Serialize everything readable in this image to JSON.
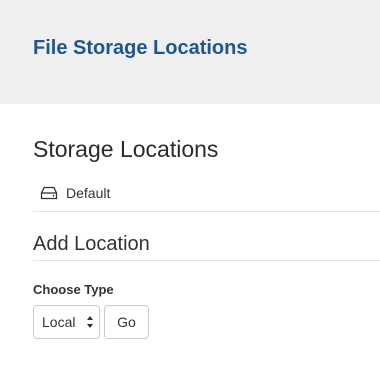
{
  "header": {
    "title": "File Storage Locations",
    "background": "#efefef",
    "title_color": "#1f5691"
  },
  "storage": {
    "title": "Storage Locations",
    "locations": [
      {
        "label": "Default",
        "icon": "hard-drive-icon"
      }
    ]
  },
  "add_location": {
    "title": "Add Location",
    "type_label": "Choose Type",
    "type_selected": "Local",
    "type_icon": "select-arrows-icon",
    "go_label": "Go"
  }
}
